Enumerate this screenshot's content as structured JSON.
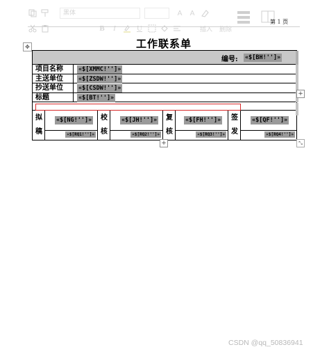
{
  "toolbar": {
    "font_name": "黑体",
    "font_grow": "A",
    "font_shrink": "A",
    "bold": "B",
    "italic": "I",
    "underline": "U",
    "insert_label": "插入",
    "delete_label": "删除"
  },
  "page_number": "第 1 页",
  "document": {
    "title": "工作联系单",
    "number_label": "编号:",
    "number_field": "«$[BH!'']»",
    "rows": [
      {
        "label": "项目名称",
        "field": "«$[XMMC!'']»"
      },
      {
        "label": "主送单位",
        "field": "«$[ZSDW!'']»"
      },
      {
        "label": "抄送单位",
        "field": "«$[CSDW!'']»"
      },
      {
        "label": "标题",
        "field": "«$[BT!'']»"
      }
    ],
    "sign_row": [
      {
        "label_top": "拟",
        "label_bottom": "稿",
        "field": "«$[NG!'']»",
        "date": "«$[RQ1!'']»"
      },
      {
        "label_top": "校",
        "label_bottom": "核",
        "field": "«$[JH!'']»",
        "date": "«$[RQ2!'']»"
      },
      {
        "label_top": "复",
        "label_bottom": "核",
        "field": "«$[FH!'']»",
        "date": "«$[RQ3!'']»"
      },
      {
        "label_top": "签",
        "label_bottom": "发",
        "field": "«$[QF!'']»",
        "date": "«$[RQ4!'']»"
      }
    ]
  },
  "controls": {
    "add_symbol": "+",
    "move_symbol": "✥",
    "resize_symbol": "⤡"
  },
  "watermark": "CSDN @qq_50836941"
}
